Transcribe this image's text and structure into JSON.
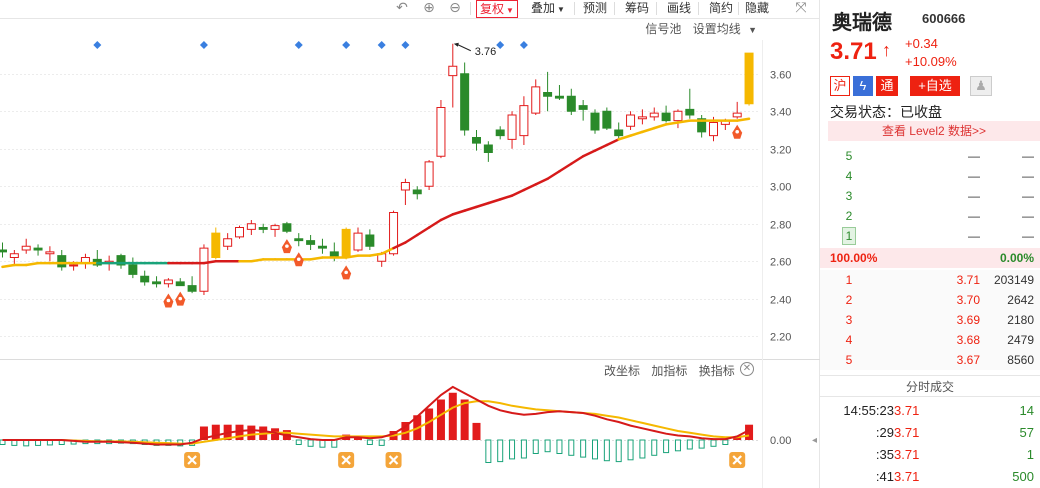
{
  "toolbar": {
    "fuquan_label": "复权",
    "diejia_label": "叠加",
    "yuce_label": "预测",
    "chouma_label": "筹码",
    "huaxian_label": "画线",
    "jianyue_label": "简约",
    "yincang_label": "隐藏"
  },
  "signal_bar": {
    "signal_pool": "信号池",
    "set_ma": "设置均线"
  },
  "sub_chart": {
    "change_axis": "改坐标",
    "add_indicator": "加指标",
    "switch_indicator": "换指标"
  },
  "stock": {
    "name": "奥瑞德",
    "code": "600666",
    "price": "3.71",
    "arrow": "↑",
    "change": "+0.34",
    "change_pct": "+10.09%",
    "tag_hu": "沪",
    "tag_tong": "通",
    "add_watch": "+自选",
    "trade_status": "交易状态：已收盘",
    "level2_link": "查看 Level2 数据>>"
  },
  "order_book": {
    "asks": [
      {
        "level": "5",
        "price": "—",
        "volume": "—"
      },
      {
        "level": "4",
        "price": "—",
        "volume": "—"
      },
      {
        "level": "3",
        "price": "—",
        "volume": "—"
      },
      {
        "level": "2",
        "price": "—",
        "volume": "—"
      },
      {
        "level": "1",
        "price": "—",
        "volume": "—"
      }
    ],
    "ratio_left": "100.00%",
    "ratio_right": "0.00%",
    "bids": [
      {
        "level": "1",
        "price": "3.71",
        "volume": "203149"
      },
      {
        "level": "2",
        "price": "3.70",
        "volume": "2642"
      },
      {
        "level": "3",
        "price": "3.69",
        "volume": "2180"
      },
      {
        "level": "4",
        "price": "3.68",
        "volume": "2479"
      },
      {
        "level": "5",
        "price": "3.67",
        "volume": "8560"
      }
    ]
  },
  "ticks": {
    "title": "分时成交",
    "rows": [
      {
        "time": "14:55:23",
        "price": "3.71",
        "volume": "14"
      },
      {
        "time": ":29",
        "price": "3.71",
        "volume": "57"
      },
      {
        "time": ":35",
        "price": "3.71",
        "volume": "1"
      },
      {
        "time": ":41",
        "price": "3.71",
        "volume": "500"
      }
    ]
  },
  "colors": {
    "up": "#e21b1b",
    "down": "#2a8a2a",
    "limit_up": "#f5b800",
    "ma_long": "#d61a1a",
    "ma_short": "#f5b800",
    "ma_flat": "#19a37a",
    "signal": "#3a7fe0"
  },
  "chart_data": [
    {
      "type": "candlestick",
      "title": "",
      "y_ticks": [
        "3.60",
        "3.40",
        "3.20",
        "3.00",
        "2.80",
        "2.60",
        "2.40",
        "2.20"
      ],
      "ylim": [
        2.1,
        3.78
      ],
      "high_annotation": "3.76",
      "candles": [
        {
          "o": 2.66,
          "h": 2.7,
          "l": 2.62,
          "c": 2.65
        },
        {
          "o": 2.62,
          "h": 2.66,
          "l": 2.58,
          "c": 2.64
        },
        {
          "o": 2.66,
          "h": 2.72,
          "l": 2.64,
          "c": 2.68
        },
        {
          "o": 2.67,
          "h": 2.69,
          "l": 2.63,
          "c": 2.66
        },
        {
          "o": 2.64,
          "h": 2.68,
          "l": 2.6,
          "c": 2.65
        },
        {
          "o": 2.63,
          "h": 2.66,
          "l": 2.55,
          "c": 2.57
        },
        {
          "o": 2.58,
          "h": 2.6,
          "l": 2.55,
          "c": 2.58
        },
        {
          "o": 2.59,
          "h": 2.64,
          "l": 2.56,
          "c": 2.62
        },
        {
          "o": 2.61,
          "h": 2.66,
          "l": 2.57,
          "c": 2.58
        },
        {
          "o": 2.59,
          "h": 2.63,
          "l": 2.55,
          "c": 2.6
        },
        {
          "o": 2.63,
          "h": 2.64,
          "l": 2.56,
          "c": 2.58
        },
        {
          "o": 2.58,
          "h": 2.62,
          "l": 2.51,
          "c": 2.53
        },
        {
          "o": 2.52,
          "h": 2.55,
          "l": 2.47,
          "c": 2.49
        },
        {
          "o": 2.49,
          "h": 2.52,
          "l": 2.46,
          "c": 2.48
        },
        {
          "o": 2.48,
          "h": 2.51,
          "l": 2.46,
          "c": 2.5
        },
        {
          "o": 2.49,
          "h": 2.51,
          "l": 2.47,
          "c": 2.47
        },
        {
          "o": 2.47,
          "h": 2.52,
          "l": 2.43,
          "c": 2.44
        },
        {
          "o": 2.44,
          "h": 2.69,
          "l": 2.42,
          "c": 2.67
        },
        {
          "o": 2.62,
          "h": 2.78,
          "l": 2.61,
          "c": 2.75,
          "limit": true
        },
        {
          "o": 2.68,
          "h": 2.75,
          "l": 2.66,
          "c": 2.72
        },
        {
          "o": 2.73,
          "h": 2.79,
          "l": 2.72,
          "c": 2.78
        },
        {
          "o": 2.77,
          "h": 2.82,
          "l": 2.74,
          "c": 2.8
        },
        {
          "o": 2.78,
          "h": 2.8,
          "l": 2.75,
          "c": 2.77
        },
        {
          "o": 2.77,
          "h": 2.8,
          "l": 2.73,
          "c": 2.79
        },
        {
          "o": 2.8,
          "h": 2.81,
          "l": 2.75,
          "c": 2.76
        },
        {
          "o": 2.72,
          "h": 2.75,
          "l": 2.68,
          "c": 2.71
        },
        {
          "o": 2.71,
          "h": 2.74,
          "l": 2.66,
          "c": 2.69
        },
        {
          "o": 2.68,
          "h": 2.72,
          "l": 2.64,
          "c": 2.67
        },
        {
          "o": 2.65,
          "h": 2.7,
          "l": 2.6,
          "c": 2.62
        },
        {
          "o": 2.62,
          "h": 2.78,
          "l": 2.61,
          "c": 2.77,
          "limit": true
        },
        {
          "o": 2.66,
          "h": 2.78,
          "l": 2.65,
          "c": 2.75
        },
        {
          "o": 2.74,
          "h": 2.77,
          "l": 2.66,
          "c": 2.68
        },
        {
          "o": 2.6,
          "h": 2.65,
          "l": 2.57,
          "c": 2.64
        },
        {
          "o": 2.64,
          "h": 2.87,
          "l": 2.63,
          "c": 2.86
        },
        {
          "o": 2.98,
          "h": 3.04,
          "l": 2.9,
          "c": 3.02
        },
        {
          "o": 2.98,
          "h": 3.0,
          "l": 2.93,
          "c": 2.96
        },
        {
          "o": 3.0,
          "h": 3.14,
          "l": 2.98,
          "c": 3.13
        },
        {
          "o": 3.16,
          "h": 3.46,
          "l": 3.15,
          "c": 3.42
        },
        {
          "o": 3.59,
          "h": 3.76,
          "l": 3.42,
          "c": 3.64
        },
        {
          "o": 3.6,
          "h": 3.66,
          "l": 3.27,
          "c": 3.3
        },
        {
          "o": 3.26,
          "h": 3.3,
          "l": 3.19,
          "c": 3.23
        },
        {
          "o": 3.22,
          "h": 3.24,
          "l": 3.13,
          "c": 3.18
        },
        {
          "o": 3.3,
          "h": 3.32,
          "l": 3.25,
          "c": 3.27
        },
        {
          "o": 3.25,
          "h": 3.4,
          "l": 3.2,
          "c": 3.38
        },
        {
          "o": 3.27,
          "h": 3.48,
          "l": 3.22,
          "c": 3.43
        },
        {
          "o": 3.39,
          "h": 3.57,
          "l": 3.38,
          "c": 3.53
        },
        {
          "o": 3.5,
          "h": 3.61,
          "l": 3.4,
          "c": 3.48
        },
        {
          "o": 3.48,
          "h": 3.54,
          "l": 3.46,
          "c": 3.47
        },
        {
          "o": 3.48,
          "h": 3.52,
          "l": 3.38,
          "c": 3.4
        },
        {
          "o": 3.43,
          "h": 3.46,
          "l": 3.35,
          "c": 3.41
        },
        {
          "o": 3.39,
          "h": 3.41,
          "l": 3.28,
          "c": 3.3
        },
        {
          "o": 3.4,
          "h": 3.42,
          "l": 3.3,
          "c": 3.31
        },
        {
          "o": 3.3,
          "h": 3.34,
          "l": 3.25,
          "c": 3.27
        },
        {
          "o": 3.32,
          "h": 3.4,
          "l": 3.3,
          "c": 3.38
        },
        {
          "o": 3.36,
          "h": 3.41,
          "l": 3.33,
          "c": 3.37
        },
        {
          "o": 3.37,
          "h": 3.42,
          "l": 3.35,
          "c": 3.39
        },
        {
          "o": 3.39,
          "h": 3.43,
          "l": 3.34,
          "c": 3.35
        },
        {
          "o": 3.35,
          "h": 3.41,
          "l": 3.31,
          "c": 3.4
        },
        {
          "o": 3.41,
          "h": 3.52,
          "l": 3.36,
          "c": 3.38
        },
        {
          "o": 3.36,
          "h": 3.38,
          "l": 3.26,
          "c": 3.29
        },
        {
          "o": 3.27,
          "h": 3.37,
          "l": 3.24,
          "c": 3.34
        },
        {
          "o": 3.33,
          "h": 3.36,
          "l": 3.3,
          "c": 3.35
        },
        {
          "o": 3.37,
          "h": 3.45,
          "l": 3.36,
          "c": 3.39
        },
        {
          "o": 3.44,
          "h": 3.71,
          "l": 3.43,
          "c": 3.71,
          "limit": true
        }
      ],
      "ma_short": [
        2.6,
        2.6,
        2.61,
        2.61,
        2.61,
        2.61,
        2.61,
        2.61,
        2.6,
        2.6,
        2.6,
        2.6,
        2.59,
        2.58,
        2.58,
        2.57,
        2.57,
        2.58,
        2.59,
        2.6,
        2.61,
        2.61,
        2.62,
        2.62,
        2.62,
        2.62,
        2.62,
        2.62,
        2.61,
        2.62,
        2.62,
        2.62,
        2.63,
        2.66,
        2.7,
        2.74,
        2.79,
        2.85,
        2.9,
        2.94,
        2.97,
        3.0,
        3.03,
        3.06,
        3.09,
        3.12,
        3.16,
        3.19,
        3.22,
        3.25,
        3.28,
        3.29,
        3.3,
        3.31,
        3.33,
        3.35,
        3.36,
        3.37,
        3.37,
        3.36,
        3.36,
        3.36,
        3.37,
        3.39
      ],
      "ma_long": [
        2.57,
        2.58,
        2.58,
        2.59,
        2.59,
        2.59,
        2.59,
        2.59,
        2.59,
        2.59,
        2.59,
        2.59,
        2.59,
        2.59,
        2.59,
        2.59,
        2.59,
        2.59,
        2.6,
        2.6,
        2.6,
        2.6,
        2.61,
        2.61,
        2.61,
        2.61,
        2.61,
        2.62,
        2.62,
        2.62,
        2.63,
        2.63,
        2.64,
        2.67,
        2.7,
        2.74,
        2.78,
        2.82,
        2.85,
        2.87,
        2.89,
        2.91,
        2.93,
        2.95,
        2.98,
        3.01,
        3.04,
        3.08,
        3.12,
        3.16,
        3.19,
        3.22,
        3.25,
        3.27,
        3.29,
        3.31,
        3.33,
        3.34,
        3.35,
        3.35,
        3.35,
        3.35,
        3.35,
        3.36
      ],
      "signals_top": [
        8,
        17,
        25,
        29,
        32,
        34,
        42,
        44
      ],
      "rocket_markers": [
        14,
        15,
        24,
        25,
        29,
        62
      ],
      "coin_markers": [
        33,
        36
      ]
    },
    {
      "type": "bar",
      "y_ticks": [
        "0.00"
      ],
      "macd": [
        -0.01,
        -0.012,
        -0.013,
        -0.012,
        -0.011,
        -0.01,
        -0.009,
        -0.008,
        -0.008,
        -0.008,
        -0.007,
        -0.008,
        -0.01,
        -0.012,
        -0.012,
        -0.013,
        -0.012,
        0.03,
        0.034,
        0.034,
        0.034,
        0.032,
        0.03,
        0.026,
        0.022,
        -0.01,
        -0.014,
        -0.016,
        -0.016,
        0.012,
        0.008,
        -0.01,
        -0.012,
        0.02,
        0.04,
        0.055,
        0.07,
        0.09,
        0.105,
        0.09,
        0.038,
        -0.05,
        -0.048,
        -0.042,
        -0.04,
        -0.03,
        -0.026,
        -0.03,
        -0.034,
        -0.038,
        -0.042,
        -0.046,
        -0.048,
        -0.044,
        -0.04,
        -0.034,
        -0.028,
        -0.024,
        -0.02,
        -0.018,
        -0.014,
        -0.01,
        0.006,
        0.034
      ],
      "dif": [
        0.0,
        0.0,
        0.0,
        0.0,
        0.0,
        0.0,
        -0.002,
        -0.004,
        -0.004,
        -0.004,
        -0.005,
        -0.006,
        -0.008,
        -0.01,
        -0.01,
        -0.01,
        -0.006,
        0.004,
        0.01,
        0.016,
        0.02,
        0.022,
        0.02,
        0.016,
        0.01,
        0.006,
        0.002,
        0.0,
        0.0,
        0.006,
        0.006,
        0.004,
        0.006,
        0.014,
        0.03,
        0.052,
        0.076,
        0.1,
        0.118,
        0.104,
        0.09,
        0.076,
        0.066,
        0.06,
        0.056,
        0.058,
        0.062,
        0.064,
        0.062,
        0.06,
        0.054,
        0.046,
        0.04,
        0.032,
        0.026,
        0.02,
        0.014,
        0.01,
        0.008,
        0.004,
        0.002,
        0.002,
        0.008,
        0.022
      ],
      "dea": [
        0.0,
        0.0,
        0.0,
        0.0,
        0.0,
        0.0,
        -0.001,
        -0.002,
        -0.003,
        -0.003,
        -0.003,
        -0.004,
        -0.005,
        -0.006,
        -0.007,
        -0.008,
        -0.008,
        -0.004,
        0.0,
        0.004,
        0.008,
        0.012,
        0.014,
        0.016,
        0.016,
        0.014,
        0.012,
        0.01,
        0.008,
        0.008,
        0.008,
        0.008,
        0.008,
        0.01,
        0.016,
        0.026,
        0.04,
        0.056,
        0.072,
        0.082,
        0.086,
        0.086,
        0.082,
        0.076,
        0.072,
        0.068,
        0.066,
        0.064,
        0.062,
        0.06,
        0.058,
        0.054,
        0.05,
        0.044,
        0.038,
        0.032,
        0.026,
        0.02,
        0.016,
        0.012,
        0.008,
        0.006,
        0.006,
        0.01
      ]
    }
  ]
}
